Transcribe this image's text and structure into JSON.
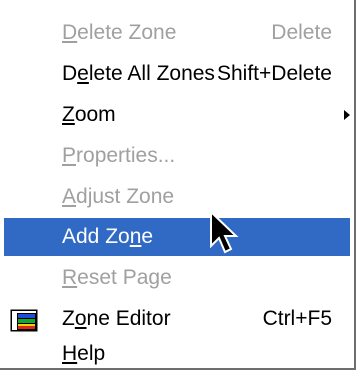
{
  "menu": {
    "items": [
      {
        "pre": "",
        "u": "D",
        "post": "elete Zone",
        "shortcut": "Delete"
      },
      {
        "pre": "D",
        "u": "e",
        "post": "lete All Zones",
        "shortcut": "Shift+Delete"
      },
      {
        "pre": "",
        "u": "Z",
        "post": "oom"
      },
      {
        "pre": "",
        "u": "P",
        "post": "roperties..."
      },
      {
        "pre": "",
        "u": "A",
        "post": "djust Zone"
      },
      {
        "pre": "Add Zo",
        "u": "n",
        "post": "e"
      },
      {
        "pre": "",
        "u": "R",
        "post": "eset Page"
      },
      {
        "pre": "Z",
        "u": "o",
        "post": "ne Editor",
        "shortcut": "Ctrl+F5"
      },
      {
        "pre": "",
        "u": "H",
        "post": "elp"
      }
    ]
  },
  "colors": {
    "highlight": "#316ac5",
    "disabled_text": "#a0a0a0",
    "menu_shadow": "#6e6e6e"
  },
  "icons": {
    "submenu": "chevron-right-icon",
    "zone_editor": "zone-editor-icon",
    "cursor": "mouse-pointer-icon"
  }
}
